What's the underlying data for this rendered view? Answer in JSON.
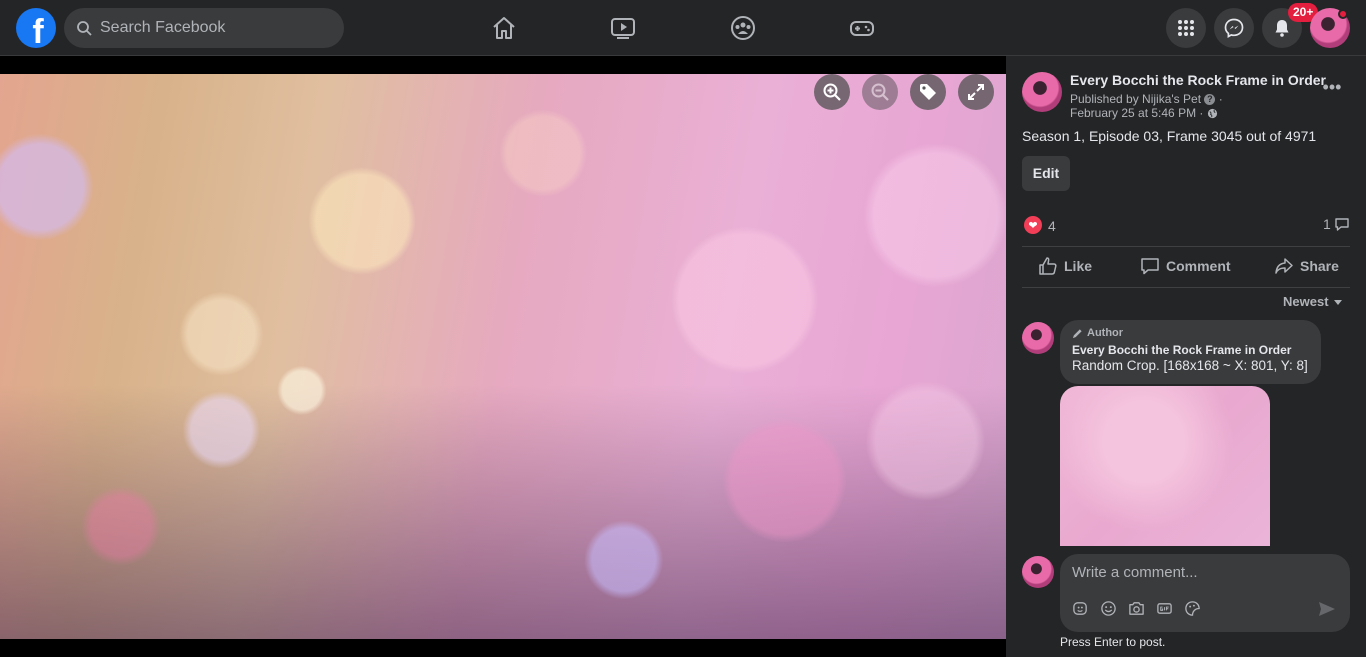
{
  "header": {
    "logo_text": "f",
    "search": {
      "placeholder": "Search Facebook"
    },
    "nav_icons": [
      "home-icon",
      "watch-icon",
      "groups-icon",
      "gaming-icon"
    ],
    "notification_badge": "20+"
  },
  "viewer": {
    "controls": [
      "zoom-in-icon",
      "zoom-out-icon",
      "tag-icon",
      "fullscreen-icon"
    ]
  },
  "post": {
    "page_name": "Every Bocchi the Rock Frame in Order",
    "published_by": "Published by Nijika's Pet",
    "date": "February 25 at 5:46 PM",
    "text": "Season 1, Episode 03, Frame 3045 out of 4971",
    "edit_label": "Edit",
    "reaction_count": "4",
    "comment_count": "1",
    "actions": {
      "like": "Like",
      "comment": "Comment",
      "share": "Share"
    },
    "sort_label": "Newest"
  },
  "comment": {
    "author_tag": "Author",
    "name": "Every Bocchi the Rock Frame in Order",
    "text": "Random Crop. [168x168 ~ X: 801, Y: 8]"
  },
  "composer": {
    "placeholder": "Write a comment...",
    "hint": "Press Enter to post."
  },
  "colors": {
    "accent": "#1877f2",
    "badge": "#e41e3f",
    "background": "#18191a",
    "surface": "#242526",
    "love": "#f33e58"
  }
}
